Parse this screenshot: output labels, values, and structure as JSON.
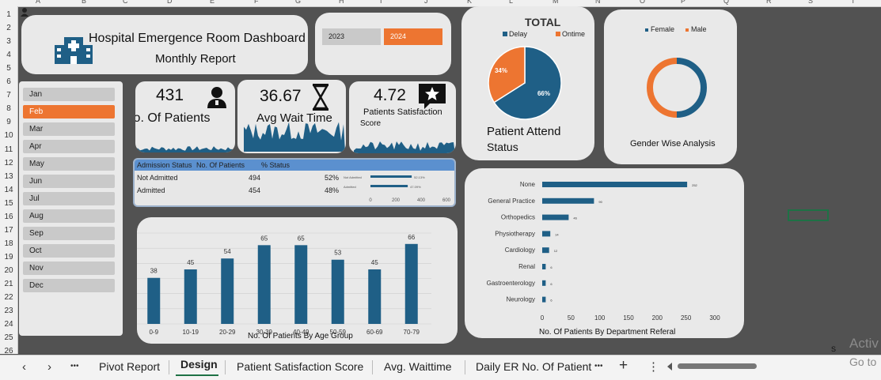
{
  "sheet": {
    "columns": [
      "A",
      "B",
      "C",
      "D",
      "E",
      "F",
      "G",
      "H",
      "I",
      "J",
      "K",
      "L",
      "M",
      "N",
      "O",
      "P",
      "Q",
      "R",
      "S",
      "T"
    ],
    "rows": [
      "1",
      "2",
      "3",
      "4",
      "5",
      "6",
      "7",
      "8",
      "9",
      "10",
      "11",
      "12",
      "13",
      "14",
      "15",
      "16",
      "17",
      "18",
      "19",
      "20",
      "21",
      "22",
      "23",
      "24",
      "25",
      "26"
    ]
  },
  "title": {
    "line1": "Hospital Emergence Room Dashboard",
    "line2": "Monthly Report"
  },
  "years": {
    "y2023": "2023",
    "y2024": "2024",
    "selected": "2024"
  },
  "months": [
    {
      "label": "Jan",
      "selected": false
    },
    {
      "label": "Feb",
      "selected": true
    },
    {
      "label": "Mar",
      "selected": false
    },
    {
      "label": "Apr",
      "selected": false
    },
    {
      "label": "May",
      "selected": false
    },
    {
      "label": "Jun",
      "selected": false
    },
    {
      "label": "Jul",
      "selected": false
    },
    {
      "label": "Aug",
      "selected": false
    },
    {
      "label": "Sep",
      "selected": false
    },
    {
      "label": "Oct",
      "selected": false
    },
    {
      "label": "Nov",
      "selected": false
    },
    {
      "label": "Dec",
      "selected": false
    }
  ],
  "kpis": {
    "patients": {
      "value": "431",
      "label": "No. Of Patients"
    },
    "wait": {
      "value": "36.67",
      "label": "Avg Wait Time"
    },
    "satisfaction": {
      "value": "4.72",
      "label1": "Patients Satisfaction",
      "label2": "Score"
    }
  },
  "admission": {
    "headers": {
      "status": "Admission Status",
      "patients": "No. Of Patients",
      "pct": "% Status"
    },
    "rows": [
      {
        "status": "Not Admitted",
        "patients": "494",
        "pct": "52%",
        "bar_label": "52.13%",
        "value": 52.13
      },
      {
        "status": "Admitted",
        "patients": "454",
        "pct": "48%",
        "bar_label": "47.09%",
        "value": 47.09
      }
    ],
    "axis": [
      "0",
      "200",
      "400",
      "600"
    ]
  },
  "total_pie": {
    "title": "TOTAL",
    "legend": [
      {
        "name": "Delay",
        "color": "#1f5f86"
      },
      {
        "name": "Ontime",
        "color": "#ed7531"
      }
    ],
    "label_delay": "66%",
    "label_ontime": "34%",
    "delay_share": 0.66,
    "caption1": "Patient Attend",
    "caption2": "Status"
  },
  "gender": {
    "legend": [
      {
        "name": "Female",
        "color": "#1f5f86"
      },
      {
        "name": "Male",
        "color": "#ed7531"
      }
    ],
    "female_share": 0.5,
    "caption": "Gender Wise Analysis"
  },
  "chart_data": [
    {
      "type": "bar",
      "title": "No. Of Patients By Age Group",
      "categories": [
        "0-9",
        "10-19",
        "20-29",
        "30-39",
        "40-49",
        "50-59",
        "60-69",
        "70-79"
      ],
      "values": [
        38,
        45,
        54,
        65,
        65,
        53,
        45,
        66
      ],
      "value_labels": [
        "38",
        "45",
        "54",
        "65",
        "65",
        "53",
        "45",
        "66"
      ],
      "ylim": [
        0,
        75
      ],
      "color": "#1f5f86",
      "grid": true
    },
    {
      "type": "bar",
      "orientation": "horizontal",
      "title": "No. Of Patients By Department Referal",
      "categories": [
        "None",
        "General Practice",
        "Orthopedics",
        "Physiotherapy",
        "Cardiology",
        "Renal",
        "Gastroenterology",
        "Neurology"
      ],
      "values": [
        252,
        90,
        46,
        14,
        12,
        6,
        6,
        6
      ],
      "value_labels": [
        "252",
        "90",
        "46",
        "14",
        "12",
        "6",
        "6",
        "6"
      ],
      "ticks": [
        "0",
        "50",
        "100",
        "150",
        "200",
        "250",
        "300"
      ],
      "xlim": [
        0,
        300
      ],
      "color": "#1f5f86"
    }
  ],
  "tabs": {
    "items": [
      "Pivot Report",
      "Design",
      "Patient Satisfaction Score",
      "Avg. Waittime",
      "Daily ER No. Of Patient"
    ],
    "active": "Design",
    "overflow": "•••",
    "add": "+",
    "menu": "⋮"
  },
  "watermark": {
    "line1": "Activ",
    "line2": "Go to"
  },
  "stray_s": "S"
}
